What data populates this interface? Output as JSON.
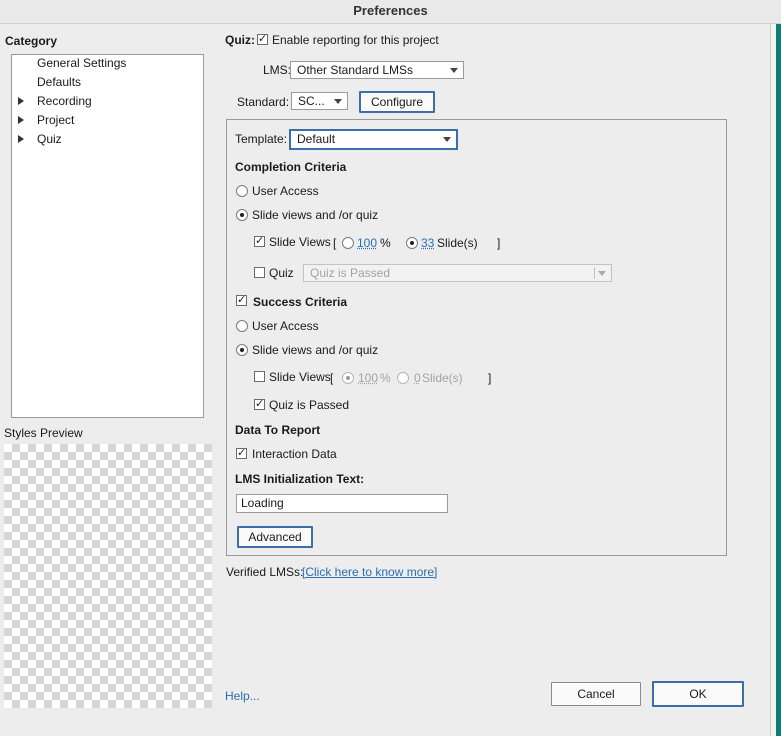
{
  "window": {
    "title": "Preferences"
  },
  "sidebar": {
    "category_label": "Category",
    "items": [
      {
        "label": "General Settings",
        "expandable": false
      },
      {
        "label": "Defaults",
        "expandable": false
      },
      {
        "label": "Recording",
        "expandable": true
      },
      {
        "label": "Project",
        "expandable": true
      },
      {
        "label": "Quiz",
        "expandable": true
      }
    ],
    "styles_preview_label": "Styles Preview"
  },
  "reporting": {
    "quiz_label": "Quiz:",
    "enable_label": "Enable reporting for this project",
    "enable_checked": true,
    "lms_label": "LMS:",
    "lms_value": "Other Standard LMSs",
    "standard_label": "Standard:",
    "standard_value": "SC...",
    "configure_label": "Configure"
  },
  "template": {
    "label": "Template:",
    "value": "Default"
  },
  "completion": {
    "heading": "Completion Criteria",
    "user_access_label": "User Access",
    "slide_views_quiz_label": "Slide views and /or quiz",
    "slide_views_label": "Slide Views",
    "slide_views_checked": true,
    "open_bracket": "[",
    "close_bracket": "]",
    "percent_value": "100",
    "percent_unit": "%",
    "slides_value": "33",
    "slides_unit": "Slide(s)",
    "quiz_label": "Quiz",
    "quiz_checked": false,
    "quiz_select_value": "Quiz is Passed"
  },
  "success": {
    "heading": "Success Criteria",
    "heading_checked": true,
    "user_access_label": "User Access",
    "slide_views_quiz_label": "Slide views and /or quiz",
    "slide_views_label": "Slide Views",
    "slide_views_checked": false,
    "open_bracket": "[",
    "close_bracket": "]",
    "percent_value": "100",
    "percent_unit": "%",
    "slides_value": "0",
    "slides_unit": "Slide(s)",
    "quiz_passed_label": "Quiz is Passed",
    "quiz_passed_checked": true
  },
  "data_to_report": {
    "heading": "Data To Report",
    "interaction_label": "Interaction Data",
    "interaction_checked": true
  },
  "lms_init": {
    "heading": "LMS Initialization Text:",
    "value": "Loading"
  },
  "advanced_label": "Advanced",
  "verified": {
    "label": "Verified LMSs:",
    "link": "[Click here to know more]"
  },
  "footer": {
    "help": "Help...",
    "cancel": "Cancel",
    "ok": "OK"
  }
}
